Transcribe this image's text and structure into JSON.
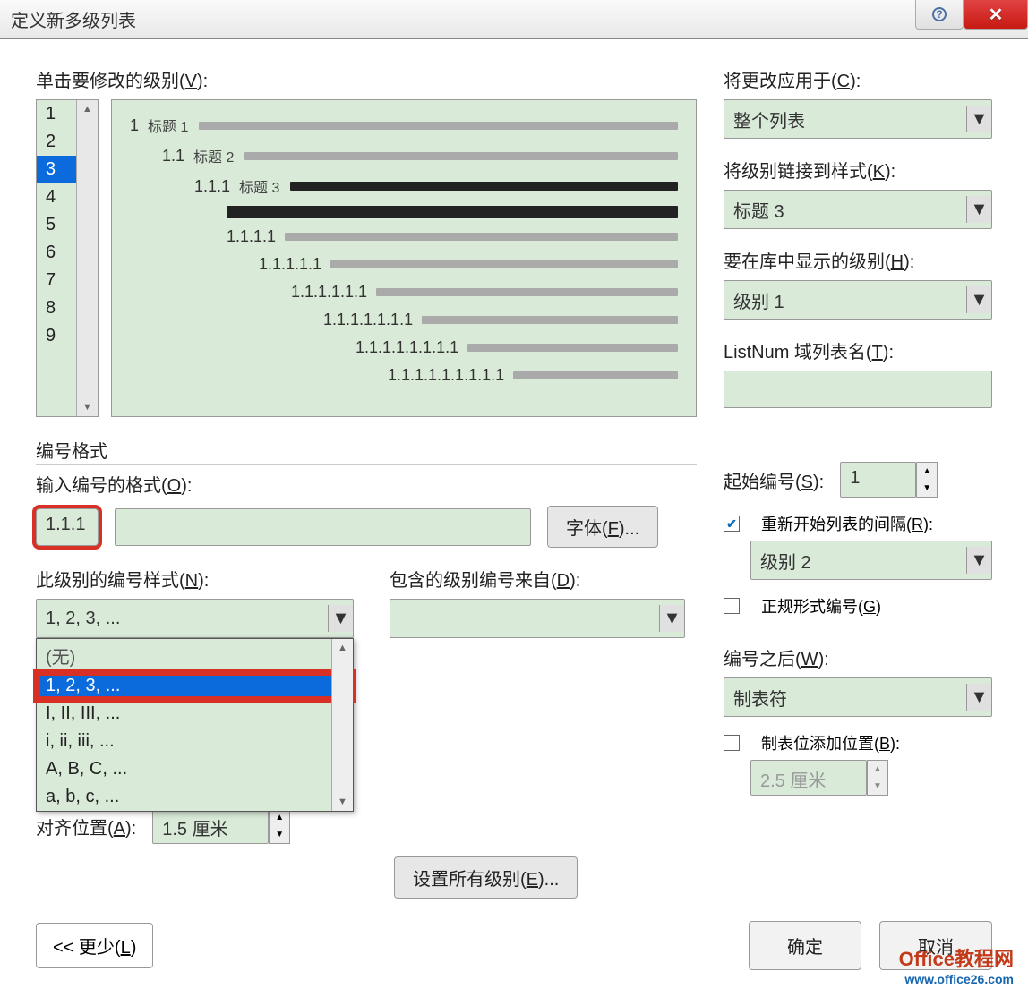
{
  "title": "定义新多级列表",
  "labels": {
    "click_level": "单击要修改的级别(",
    "click_level_key": "V",
    "apply_to": "将更改应用于(",
    "apply_to_key": "C",
    "link_style": "将级别链接到样式(",
    "link_style_key": "K",
    "show_level": "要在库中显示的级别(",
    "show_level_key": "H",
    "listnum": "ListNum 域列表名(",
    "listnum_key": "T",
    "number_format_group": "编号格式",
    "input_format": "输入编号的格式(",
    "input_format_key": "O",
    "font_btn": "字体(",
    "font_btn_key": "F",
    "number_style": "此级别的编号样式(",
    "number_style_key": "N",
    "include_from": "包含的级别编号来自(",
    "include_from_key": "D",
    "start_at": "起始编号(",
    "start_at_key": "S",
    "restart": "重新开始列表的间隔(",
    "restart_key": "R",
    "legal": "正规形式编号(",
    "legal_key": "G",
    "align_pos": "对齐位置(",
    "align_pos_key": "A",
    "set_all": "设置所有级别(",
    "set_all_key": "E",
    "follow_number": "编号之后(",
    "follow_number_key": "W",
    "tab_stop": "制表位添加位置(",
    "tab_stop_key": "B",
    "less": "<< 更少(",
    "less_key": "L",
    "ok": "确定",
    "cancel": "取消",
    "close_paren": "):"
  },
  "levels": [
    "1",
    "2",
    "3",
    "4",
    "5",
    "6",
    "7",
    "8",
    "9"
  ],
  "selected_level": "3",
  "preview": [
    {
      "num": "1",
      "label": "标题 1",
      "indent": 0,
      "dark": false
    },
    {
      "num": "1.1",
      "label": "标题 2",
      "indent": 1,
      "dark": false
    },
    {
      "num": "1.1.1",
      "label": "标题 3",
      "indent": 2,
      "dark": true
    },
    {
      "num": "",
      "label": "",
      "indent": 3,
      "dark": true,
      "thick": true
    },
    {
      "num": "1.1.1.1",
      "label": "",
      "indent": 3,
      "dark": false
    },
    {
      "num": "1.1.1.1.1",
      "label": "",
      "indent": 4,
      "dark": false
    },
    {
      "num": "1.1.1.1.1.1",
      "label": "",
      "indent": 5,
      "dark": false
    },
    {
      "num": "1.1.1.1.1.1.1",
      "label": "",
      "indent": 6,
      "dark": false
    },
    {
      "num": "1.1.1.1.1.1.1.1",
      "label": "",
      "indent": 7,
      "dark": false
    },
    {
      "num": "1.1.1.1.1.1.1.1.1",
      "label": "",
      "indent": 8,
      "dark": false
    }
  ],
  "apply_to_value": "整个列表",
  "link_style_value": "标题 3",
  "show_level_value": "级别 1",
  "listnum_value": "",
  "format_value": "1.1.1",
  "number_style_value": "1, 2, 3, ...",
  "number_style_options": [
    "(无)",
    "1, 2, 3, ...",
    "I, II, III, ...",
    "i, ii, iii, ...",
    "A, B, C, ...",
    "a, b, c, ..."
  ],
  "number_style_selected_index": 1,
  "start_at_value": "1",
  "restart_checked": true,
  "restart_value": "级别 2",
  "legal_checked": false,
  "align_pos_value": "1.5 厘米",
  "follow_number_value": "制表符",
  "tab_stop_checked": false,
  "tab_stop_value": "2.5 厘米",
  "watermark": {
    "line1": "Office教程网",
    "line2": "www.office26.com"
  }
}
